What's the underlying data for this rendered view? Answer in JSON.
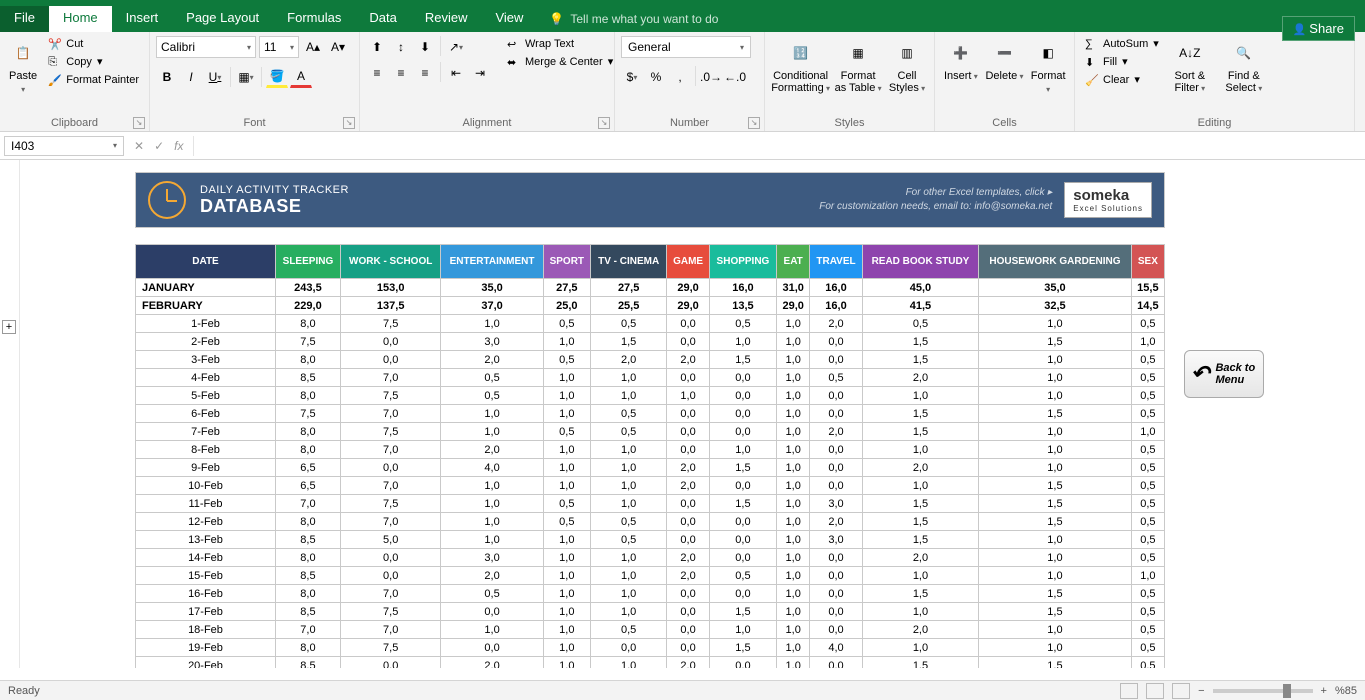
{
  "app": {
    "share": "Share"
  },
  "tabs": [
    "File",
    "Home",
    "Insert",
    "Page Layout",
    "Formulas",
    "Data",
    "Review",
    "View"
  ],
  "active_tab": "Home",
  "tellme": "Tell me what you want to do",
  "ribbon": {
    "clipboard": {
      "label": "Clipboard",
      "paste": "Paste",
      "cut": "Cut",
      "copy": "Copy",
      "fp": "Format Painter"
    },
    "font": {
      "label": "Font",
      "name": "Calibri",
      "size": "11"
    },
    "alignment": {
      "label": "Alignment",
      "wrap": "Wrap Text",
      "merge": "Merge & Center"
    },
    "number": {
      "label": "Number",
      "fmt": "General"
    },
    "styles": {
      "label": "Styles",
      "cf": "Conditional Formatting",
      "fat": "Format as Table",
      "cs": "Cell Styles"
    },
    "cells": {
      "label": "Cells",
      "insert": "Insert",
      "delete": "Delete",
      "format": "Format"
    },
    "editing": {
      "label": "Editing",
      "autosum": "AutoSum",
      "fill": "Fill",
      "clear": "Clear",
      "sort": "Sort & Filter",
      "find": "Find & Select"
    }
  },
  "namebox": "I403",
  "header": {
    "sub": "DAILY ACTIVITY TRACKER",
    "main": "DATABASE",
    "r1": "For other Excel templates, click ▸",
    "r2": "For customization needs, email to: info@someka.net",
    "logo": "someka",
    "logo_sub": "Excel Solutions"
  },
  "backmenu": "Back to Menu",
  "columns": [
    "DATE",
    "SLEEPING",
    "WORK - SCHOOL",
    "ENTERTAINMENT",
    "SPORT",
    "TV - CINEMA",
    "GAME",
    "SHOPPING",
    "EAT",
    "TRAVEL",
    "READ BOOK STUDY",
    "HOUSEWORK GARDENING",
    "SEX"
  ],
  "summary": [
    {
      "label": "JANUARY",
      "v": [
        "243,5",
        "153,0",
        "35,0",
        "27,5",
        "27,5",
        "29,0",
        "16,0",
        "31,0",
        "16,0",
        "45,0",
        "35,0",
        "15,5"
      ]
    },
    {
      "label": "FEBRUARY",
      "v": [
        "229,0",
        "137,5",
        "37,0",
        "25,0",
        "25,5",
        "29,0",
        "13,5",
        "29,0",
        "16,0",
        "41,5",
        "32,5",
        "14,5"
      ]
    }
  ],
  "rows": [
    {
      "d": "1-Feb",
      "v": [
        "8,0",
        "7,5",
        "1,0",
        "0,5",
        "0,5",
        "0,0",
        "0,5",
        "1,0",
        "2,0",
        "0,5",
        "1,0",
        "0,5"
      ]
    },
    {
      "d": "2-Feb",
      "v": [
        "7,5",
        "0,0",
        "3,0",
        "1,0",
        "1,5",
        "0,0",
        "1,0",
        "1,0",
        "0,0",
        "1,5",
        "1,5",
        "1,0"
      ]
    },
    {
      "d": "3-Feb",
      "v": [
        "8,0",
        "0,0",
        "2,0",
        "0,5",
        "2,0",
        "2,0",
        "1,5",
        "1,0",
        "0,0",
        "1,5",
        "1,0",
        "0,5"
      ]
    },
    {
      "d": "4-Feb",
      "v": [
        "8,5",
        "7,0",
        "0,5",
        "1,0",
        "1,0",
        "0,0",
        "0,0",
        "1,0",
        "0,5",
        "2,0",
        "1,0",
        "0,5"
      ]
    },
    {
      "d": "5-Feb",
      "v": [
        "8,0",
        "7,5",
        "0,5",
        "1,0",
        "1,0",
        "1,0",
        "0,0",
        "1,0",
        "0,0",
        "1,0",
        "1,0",
        "0,5"
      ]
    },
    {
      "d": "6-Feb",
      "v": [
        "7,5",
        "7,0",
        "1,0",
        "1,0",
        "0,5",
        "0,0",
        "0,0",
        "1,0",
        "0,0",
        "1,5",
        "1,5",
        "0,5"
      ]
    },
    {
      "d": "7-Feb",
      "v": [
        "8,0",
        "7,5",
        "1,0",
        "0,5",
        "0,5",
        "0,0",
        "0,0",
        "1,0",
        "2,0",
        "1,5",
        "1,0",
        "1,0"
      ]
    },
    {
      "d": "8-Feb",
      "v": [
        "8,0",
        "7,0",
        "2,0",
        "1,0",
        "1,0",
        "0,0",
        "1,0",
        "1,0",
        "0,0",
        "1,0",
        "1,0",
        "0,5"
      ]
    },
    {
      "d": "9-Feb",
      "v": [
        "6,5",
        "0,0",
        "4,0",
        "1,0",
        "1,0",
        "2,0",
        "1,5",
        "1,0",
        "0,0",
        "2,0",
        "1,0",
        "0,5"
      ]
    },
    {
      "d": "10-Feb",
      "v": [
        "6,5",
        "7,0",
        "1,0",
        "1,0",
        "1,0",
        "2,0",
        "0,0",
        "1,0",
        "0,0",
        "1,0",
        "1,5",
        "0,5"
      ]
    },
    {
      "d": "11-Feb",
      "v": [
        "7,0",
        "7,5",
        "1,0",
        "0,5",
        "1,0",
        "0,0",
        "1,5",
        "1,0",
        "3,0",
        "1,5",
        "1,5",
        "0,5"
      ]
    },
    {
      "d": "12-Feb",
      "v": [
        "8,0",
        "7,0",
        "1,0",
        "0,5",
        "0,5",
        "0,0",
        "0,0",
        "1,0",
        "2,0",
        "1,5",
        "1,5",
        "0,5"
      ]
    },
    {
      "d": "13-Feb",
      "v": [
        "8,5",
        "5,0",
        "1,0",
        "1,0",
        "0,5",
        "0,0",
        "0,0",
        "1,0",
        "3,0",
        "1,5",
        "1,0",
        "0,5"
      ]
    },
    {
      "d": "14-Feb",
      "v": [
        "8,0",
        "0,0",
        "3,0",
        "1,0",
        "1,0",
        "2,0",
        "0,0",
        "1,0",
        "0,0",
        "2,0",
        "1,0",
        "0,5"
      ]
    },
    {
      "d": "15-Feb",
      "v": [
        "8,5",
        "0,0",
        "2,0",
        "1,0",
        "1,0",
        "2,0",
        "0,5",
        "1,0",
        "0,0",
        "1,0",
        "1,0",
        "1,0"
      ]
    },
    {
      "d": "16-Feb",
      "v": [
        "8,0",
        "7,0",
        "0,5",
        "1,0",
        "1,0",
        "0,0",
        "0,0",
        "1,0",
        "0,0",
        "1,5",
        "1,5",
        "0,5"
      ]
    },
    {
      "d": "17-Feb",
      "v": [
        "8,5",
        "7,5",
        "0,0",
        "1,0",
        "1,0",
        "0,0",
        "1,5",
        "1,0",
        "0,0",
        "1,0",
        "1,5",
        "0,5"
      ]
    },
    {
      "d": "18-Feb",
      "v": [
        "7,0",
        "7,0",
        "1,0",
        "1,0",
        "0,5",
        "0,0",
        "1,0",
        "1,0",
        "0,0",
        "2,0",
        "1,0",
        "0,5"
      ]
    },
    {
      "d": "19-Feb",
      "v": [
        "8,0",
        "7,5",
        "0,0",
        "1,0",
        "0,0",
        "0,0",
        "1,5",
        "1,0",
        "4,0",
        "1,0",
        "1,0",
        "0,5"
      ]
    },
    {
      "d": "20-Feb",
      "v": [
        "8,5",
        "0,0",
        "2,0",
        "1,0",
        "1,0",
        "2,0",
        "0,0",
        "1,0",
        "0,0",
        "1,5",
        "1,5",
        "0,5"
      ]
    }
  ],
  "status": {
    "ready": "Ready",
    "zoom": "%85"
  }
}
